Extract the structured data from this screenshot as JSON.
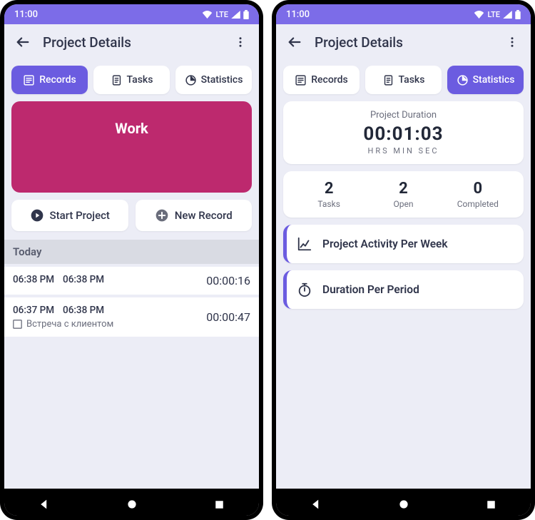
{
  "status": {
    "time": "11:00",
    "network": "LTE"
  },
  "app_bar": {
    "title": "Project Details"
  },
  "tabs": {
    "records": "Records",
    "tasks": "Tasks",
    "statistics": "Statistics"
  },
  "left": {
    "project_name": "Work",
    "start_btn": "Start Project",
    "new_record_btn": "New Record",
    "today_label": "Today",
    "records": [
      {
        "start": "06:38 PM",
        "end": "06:38 PM",
        "duration": "00:00:16",
        "task": ""
      },
      {
        "start": "06:37 PM",
        "end": "06:38 PM",
        "duration": "00:00:47",
        "task": "Встреча с клиентом"
      }
    ]
  },
  "right": {
    "duration_label": "Project Duration",
    "duration_value": "00:01:03",
    "duration_units": "HRS  MIN  SEC",
    "counts": [
      {
        "value": "2",
        "label": "Tasks"
      },
      {
        "value": "2",
        "label": "Open"
      },
      {
        "value": "0",
        "label": "Completed"
      }
    ],
    "link_activity": "Project Activity Per Week",
    "link_duration": "Duration Per Period"
  }
}
